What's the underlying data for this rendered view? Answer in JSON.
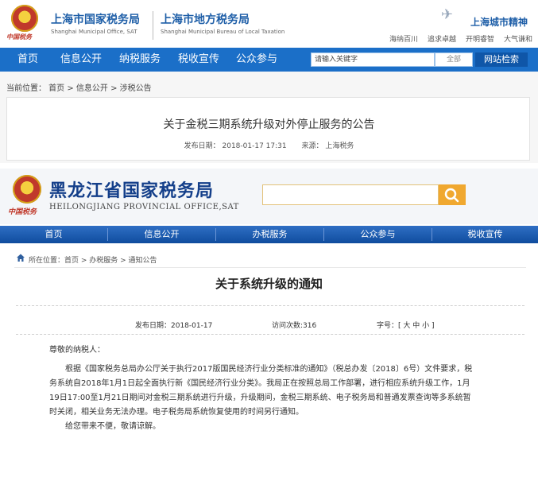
{
  "shanghai": {
    "emblem_stamp": "中国税务",
    "title_sat": "上海市国家税务局",
    "subtitle_sat": "Shanghai Municipal Office, SAT",
    "title_local": "上海市地方税务局",
    "subtitle_local": "Shanghai Municipal Bureau of Local Taxation",
    "city_spirit": "上海城市精神",
    "motto": [
      "海纳百川",
      "追求卓越",
      "开明睿智",
      "大气谦和"
    ],
    "nav": [
      "首页",
      "信息公开",
      "纳税服务",
      "税收宣传",
      "公众参与"
    ],
    "search_placeholder": "请输入关键字",
    "search_scope": "全部",
    "search_button": "网站检索",
    "breadcrumb": "当前位置： 首页 > 信息公开 > 涉税公告",
    "article_title": "关于金税三期系统升级对外停止服务的公告",
    "publish_date": "发布日期： 2018-01-17 17:31",
    "source": "来源： 上海税务"
  },
  "heilongjiang": {
    "emblem_stamp": "中国税务",
    "title": "黑龙江省国家税务局",
    "subtitle": "HEILONGJIANG PROVINCIAL OFFICE,SAT",
    "nav": [
      "首页",
      "信息公开",
      "办税服务",
      "公众参与",
      "税收宣传"
    ],
    "breadcrumb": "所在位置：首页 > 办税服务 > 通知公告",
    "article_title": "关于系统升级的通知",
    "publish_date": "发布日期：2018-01-17",
    "visits": "访问次数:316",
    "font_size": "字号：[ 大 中 小 ]",
    "greeting": "尊敬的纳税人：",
    "paragraph": "根据《国家税务总局办公厅关于执行2017版国民经济行业分类标准的通知》（税总办发〔2018〕6号）文件要求，税务系统自2018年1月1日起全面执行新《国民经济行业分类》。我局正在按照总局工作部署，进行相应系统升级工作，1月19日17:00至1月21日期间对金税三期系统进行升级，升级期间，金税三期系统、电子税务局和普通发票查询等多系统暂时关闭，相关业务无法办理。电子税务局系统恢复使用的时间另行通知。",
    "closing": "给您带来不便，敬请谅解。"
  },
  "colors": {
    "sh_nav": "#1b6fc8",
    "hl_nav": "#0f4c9e",
    "brand_blue": "#1f5fa8",
    "search_orange": "#f0a830"
  },
  "icons": [
    "tax-emblem-icon",
    "airplane-icon",
    "home-icon",
    "search-icon"
  ]
}
